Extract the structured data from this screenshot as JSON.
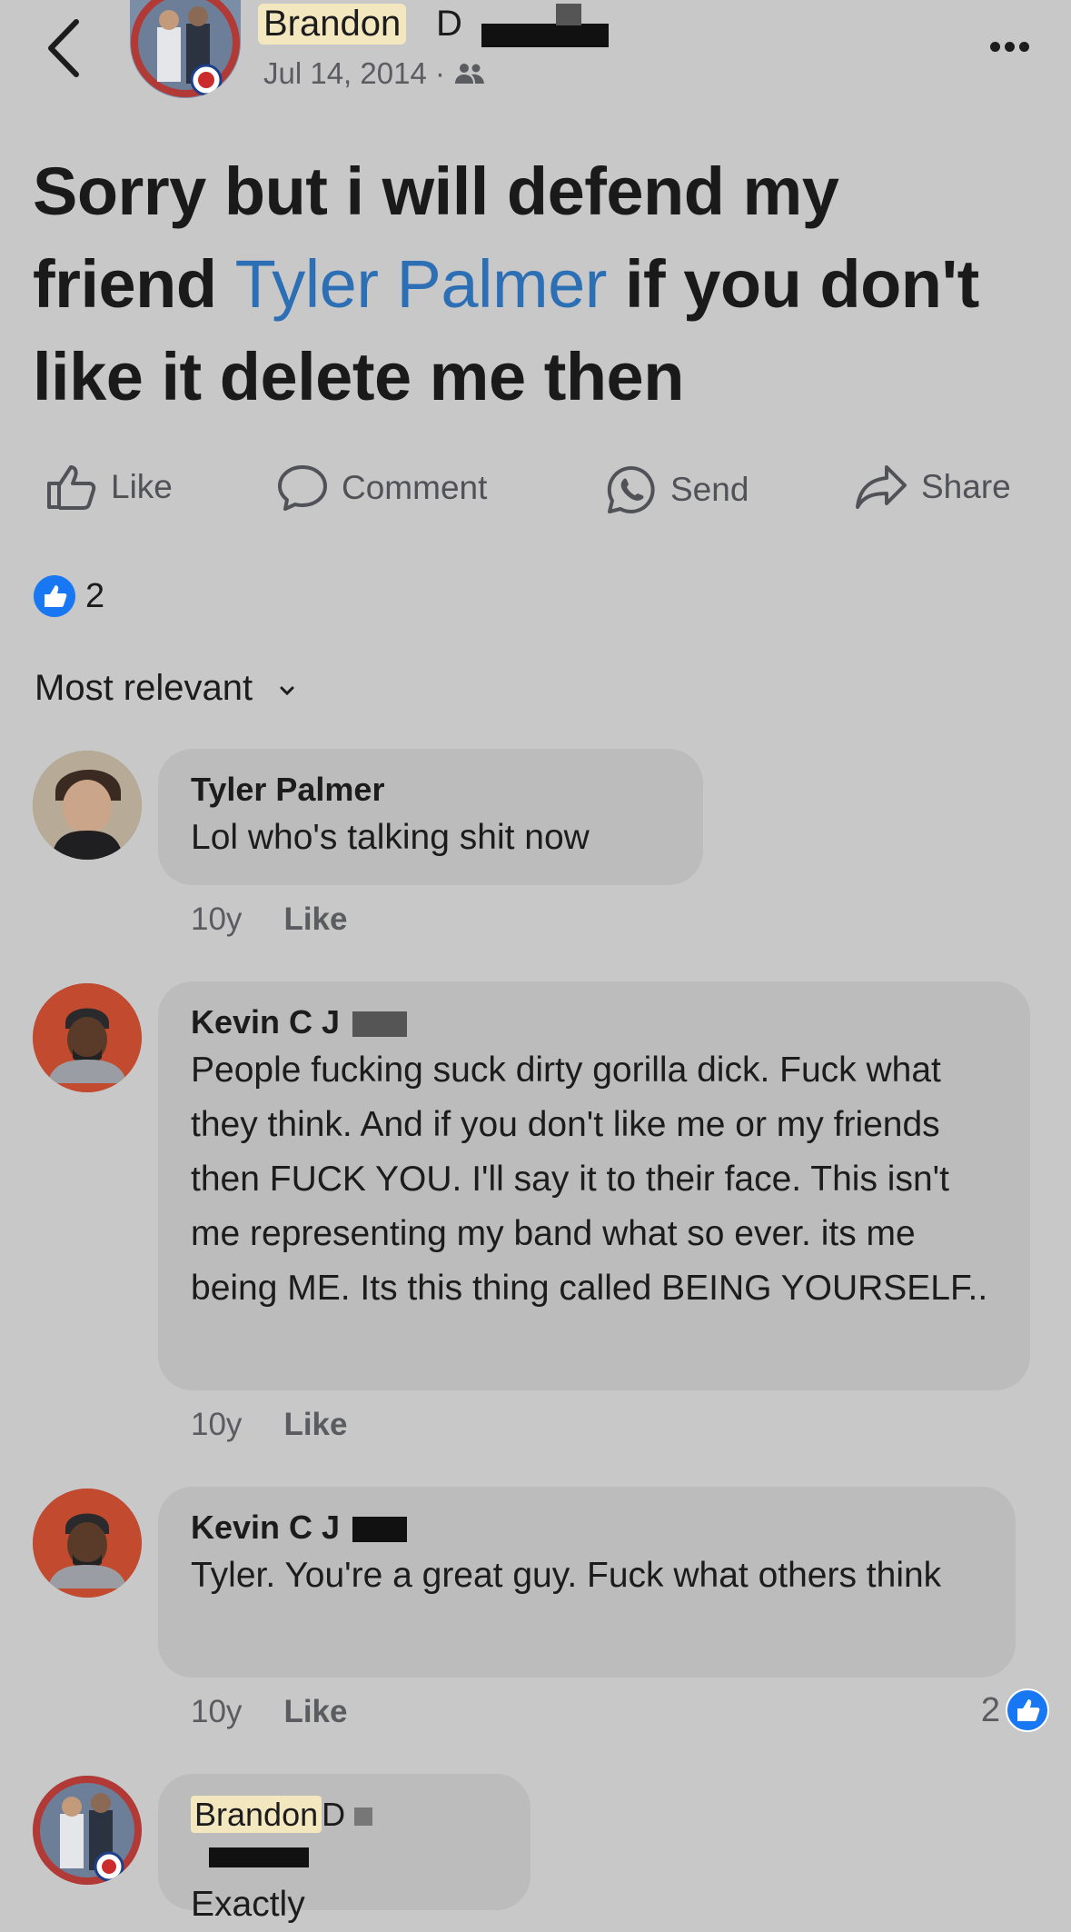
{
  "header": {
    "back_label": "Back",
    "author_name": "Brandon",
    "author_initial": "D",
    "date": "Jul 14, 2014",
    "date_sep": "·",
    "audience_icon": "friends-icon",
    "more_icon": "more-dots-icon"
  },
  "post": {
    "text_before": "Sorry but i will defend my friend ",
    "mention": "Tyler Palmer",
    "text_after": " if you don't like it delete me then"
  },
  "actions": {
    "like": "Like",
    "comment": "Comment",
    "send": "Send",
    "share": "Share"
  },
  "reactions": {
    "count": "2",
    "icon": "like-reaction-icon"
  },
  "sort": {
    "label": "Most relevant",
    "icon": "chevron-down-icon"
  },
  "comments": [
    {
      "name": "Tyler Palmer",
      "text": "Lol who's talking shit now",
      "age": "10y",
      "like": "Like"
    },
    {
      "name": "Kevin C J",
      "text": "People fucking suck dirty gorilla dick. Fuck what they think. And if you don't like me or my friends then FUCK YOU. I'll say it to their face. This isn't me representing my band what so ever. its me being ME. Its this thing called BEING YOURSELF..",
      "age": "10y",
      "like": "Like"
    },
    {
      "name": "Kevin C J",
      "text": "Tyler. You're a great guy. Fuck what others think",
      "age": "10y",
      "like": "Like",
      "reaction_count": "2"
    },
    {
      "name": "Brandon",
      "name_initial": "D",
      "text": "Exactly"
    }
  ],
  "colors": {
    "background": "#c8c8c9",
    "bubble": "#bcbcbd",
    "mention": "#2d6fb5",
    "like_blue": "#1877f2",
    "highlight": "#f3e7bf"
  }
}
